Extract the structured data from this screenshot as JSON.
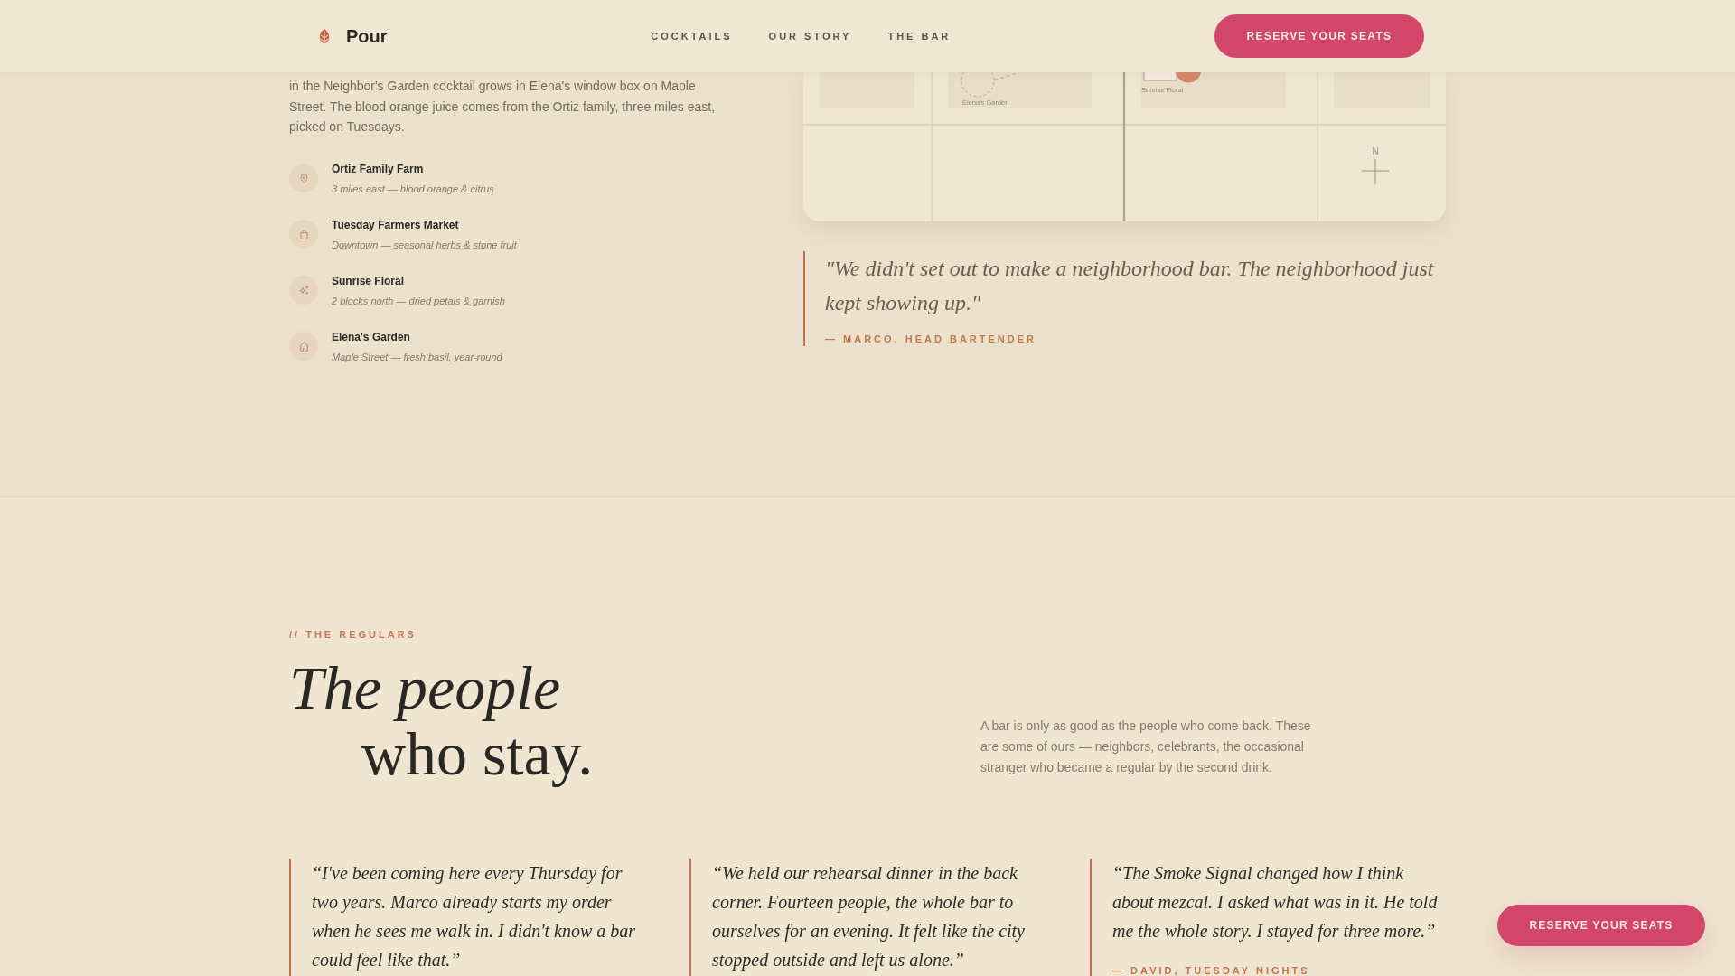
{
  "header": {
    "brand": "Pour",
    "nav": [
      {
        "label": "COCKTAILS"
      },
      {
        "label": "OUR STORY"
      },
      {
        "label": "THE BAR"
      }
    ],
    "cta": "RESERVE YOUR SEATS"
  },
  "sourcing": {
    "intro": "in the Neighbor's Garden cocktail grows in Elena's window box on Maple Street. The blood orange juice comes from the Ortiz family, three miles east, picked on Tuesdays.",
    "suppliers": [
      {
        "kind": "pin",
        "name": "Ortiz Family Farm",
        "detail": "3 miles east — blood orange & citrus"
      },
      {
        "kind": "bag",
        "name": "Tuesday Farmers Market",
        "detail": "Downtown — seasonal herbs & stone fruit"
      },
      {
        "kind": "sparkle",
        "name": "Sunrise Floral",
        "detail": "2 blocks north — dried petals & garnish"
      },
      {
        "kind": "home",
        "name": "Elena's Garden",
        "detail": "Maple Street — fresh basil, year-round"
      }
    ]
  },
  "map": {
    "pins": [
      {
        "kind": "ring",
        "label": "Elena's Garden"
      },
      {
        "kind": "marker",
        "label": "Sunrise Floral"
      }
    ],
    "compass_label": "N"
  },
  "quote": {
    "text": "\"We didn't set out to make a neighborhood bar. The neighborhood just kept showing up.\"",
    "attribution": "— MARCO, HEAD BARTENDER"
  },
  "regulars": {
    "eyebrow": "// THE REGULARS",
    "heading_line_1": "The people",
    "heading_line_2": "who stay.",
    "description": "A bar is only as good as the people who come back. These are some of ours — neighbors, celebrants, the occasional stranger who became a regular by the second drink.",
    "testimonials": [
      {
        "text": "“I've been coming here every Thursday for two years. Marco already starts my order when he sees me walk in. I didn't know a bar could feel like that.”"
      },
      {
        "text": "“We held our rehearsal dinner in the back corner. Fourteen people, the whole bar to ourselves for an evening. It felt like the city stopped outside and left us alone.”"
      },
      {
        "text": "“The Smoke Signal changed how I think about mezcal. I asked what was in it. He told me the whole story. I stayed for three more.”",
        "attribution": "— DAVID, TUESDAY NIGHTS"
      }
    ]
  },
  "floating_cta": "RESERVE YOUR SEATS"
}
